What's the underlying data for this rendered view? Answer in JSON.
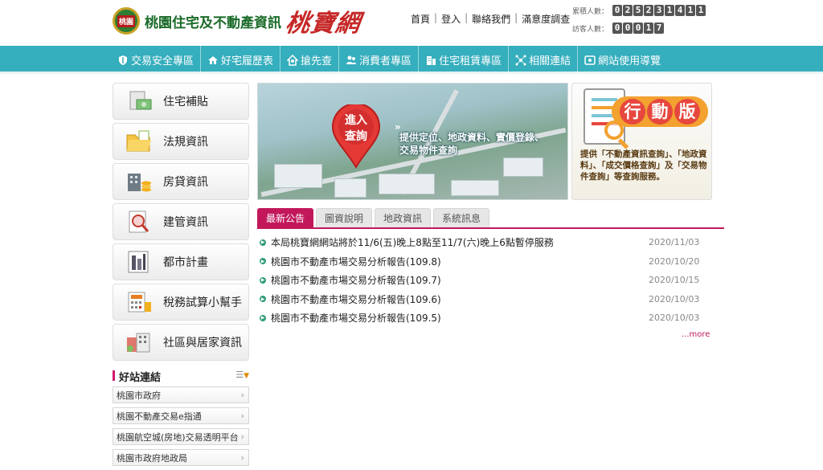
{
  "header": {
    "seal_text": "桃園",
    "site_name": "桃園住宅及不動產資訊",
    "brand": "桃寶網",
    "topnav": [
      "首頁",
      "登入",
      "聯絡我們",
      "滿意度調查"
    ],
    "counters": {
      "total_label": "累積人數：",
      "total_digits": [
        "0",
        "2",
        "5",
        "2",
        "3",
        "1",
        "4",
        "1",
        "1"
      ],
      "visitor_label": "訪客人數：",
      "visitor_digits": [
        "0",
        "0",
        "0",
        "1",
        "7"
      ]
    }
  },
  "mainnav": [
    {
      "label": "交易安全專區",
      "icon": "shield-icon"
    },
    {
      "label": "好宅履歷表",
      "icon": "house-icon"
    },
    {
      "label": "搶先查",
      "icon": "home-search-icon"
    },
    {
      "label": "消費者專區",
      "icon": "users-icon"
    },
    {
      "label": "住宅租賃專區",
      "icon": "building-icon"
    },
    {
      "label": "相關連結",
      "icon": "network-icon"
    },
    {
      "label": "網站使用導覽",
      "icon": "guide-icon"
    }
  ],
  "sidebar": [
    {
      "label": "住宅補貼",
      "icon": "subsidy-icon"
    },
    {
      "label": "法規資訊",
      "icon": "folder-icon"
    },
    {
      "label": "房貸資訊",
      "icon": "coins-icon"
    },
    {
      "label": "建管資訊",
      "icon": "document-search-icon"
    },
    {
      "label": "都市計畫",
      "icon": "city-plan-icon"
    },
    {
      "label": "稅務試算小幫手",
      "icon": "calculator-icon"
    },
    {
      "label": "社區與居家資訊",
      "icon": "community-icon"
    }
  ],
  "links": {
    "title": "好站連結",
    "more": "☰",
    "items": [
      "桃園市政府",
      "桃園不動產交易e指通",
      "桃園航空城(房地)交易透明平台",
      "桃園市政府地政局"
    ]
  },
  "banner_main": {
    "pin_text": [
      "進入",
      "查詢"
    ],
    "caption_line1": "提供定位、地政資料、實價登錄、",
    "caption_line2": "交易物件查詢"
  },
  "banner_mobile": {
    "badge": [
      "行",
      "動",
      "版"
    ],
    "desc": "提供「不動產資訊查詢」、「地政資料」、「成交價格查詢」及「交易物件查詢」等查詢服務。"
  },
  "tabs": [
    "最新公告",
    "圖資說明",
    "地政資訊",
    "系統訊息"
  ],
  "news": [
    {
      "title": "本局桃寶網網站將於11/6(五)晚上8點至11/7(六)晚上6點暫停服務",
      "date": "2020/11/03"
    },
    {
      "title": "桃園市不動產市場交易分析報告(109.8)",
      "date": "2020/10/20"
    },
    {
      "title": "桃園市不動產市場交易分析報告(109.7)",
      "date": "2020/10/15"
    },
    {
      "title": "桃園市不動產市場交易分析報告(109.6)",
      "date": "2020/10/03"
    },
    {
      "title": "桃園市不動產市場交易分析報告(109.5)",
      "date": "2020/10/03"
    }
  ],
  "news_more": "...more"
}
